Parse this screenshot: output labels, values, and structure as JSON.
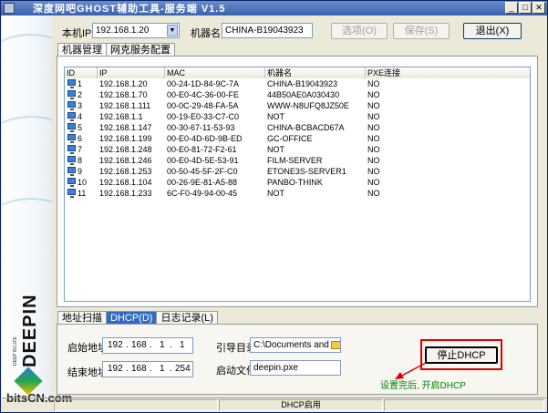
{
  "window": {
    "title": "深度网吧GHOST辅助工具-服务端  V1.5",
    "accent": "#3a62b0"
  },
  "toolbar": {
    "local_ip_label": "本机IP",
    "local_ip_value": "192.168.1.20",
    "machine_name_label": "机器名",
    "machine_name_value": "CHINA-B19043923",
    "options_label": "选项(O)",
    "save_label": "保存(S)",
    "exit_label": "退出(X)"
  },
  "top_tabs": [
    "机器管理",
    "网克服务配置"
  ],
  "table": {
    "columns": [
      "ID",
      "IP",
      "MAC",
      "机器名",
      "PXE连接"
    ],
    "rows": [
      [
        "1",
        "192.168.1.20",
        "00-24-1D-84-9C-7A",
        "CHINA-B19043923",
        "NO"
      ],
      [
        "2",
        "192.168.1.70",
        "00-E0-4C-36-00-FE",
        "44B50AE0A030430",
        "NO"
      ],
      [
        "3",
        "192.168.1.111",
        "00-0C-29-48-FA-5A",
        "WWW-N8UFQ8JZ50E",
        "NO"
      ],
      [
        "4",
        "192.168.1.1",
        "00-19-E0-33-C7-C0",
        "NOT",
        "NO"
      ],
      [
        "5",
        "192.168.1.147",
        "00-30-67-11-53-93",
        "CHINA-BCBACD67A",
        "NO"
      ],
      [
        "6",
        "192.168.1.199",
        "00-E0-4D-6D-9B-ED",
        "GC-OFFICE",
        "NO"
      ],
      [
        "7",
        "192.168.1.248",
        "00-E0-81-72-F2-61",
        "NOT",
        "NO"
      ],
      [
        "8",
        "192.168.1.246",
        "00-E0-4D-5E-53-91",
        "FILM-SERVER",
        "NO"
      ],
      [
        "9",
        "192.168.1.253",
        "00-50-45-5F-2F-C0",
        "ETONE3S-SERVER1",
        "NO"
      ],
      [
        "10",
        "192.168.1.104",
        "00-26-9E-81-A5-88",
        "PANBO-THINK",
        "NO"
      ],
      [
        "11",
        "192.168.1.233",
        "6C-F0-49-94-00-45",
        "NOT",
        "NO"
      ]
    ]
  },
  "bottom_tabs": [
    "地址扫描",
    "DHCP(D)",
    "日志记录(L)"
  ],
  "dhcp": {
    "start_label": "启始地址",
    "start_ip": [
      "192",
      "168",
      "1",
      "1"
    ],
    "end_label": "结束地址",
    "end_ip": [
      "192",
      "168",
      "1",
      "254"
    ],
    "boot_dir_label": "引导目录",
    "boot_dir_value": "C:\\Documents and Setl",
    "boot_file_label": "启动文件",
    "boot_file_value": "deepin.pxe",
    "stop_button_label": "停止DHCP",
    "hint": "设置完后, 开启DHCP",
    "hint_color": "#008000",
    "annotation_color": "#e00000"
  },
  "sidebar": {
    "brand": "DEEPIN",
    "tagline": "DEEP IN LIFE",
    "watermark": "bitsCN.com"
  },
  "statusbar": {
    "center": "DHCP启用"
  }
}
